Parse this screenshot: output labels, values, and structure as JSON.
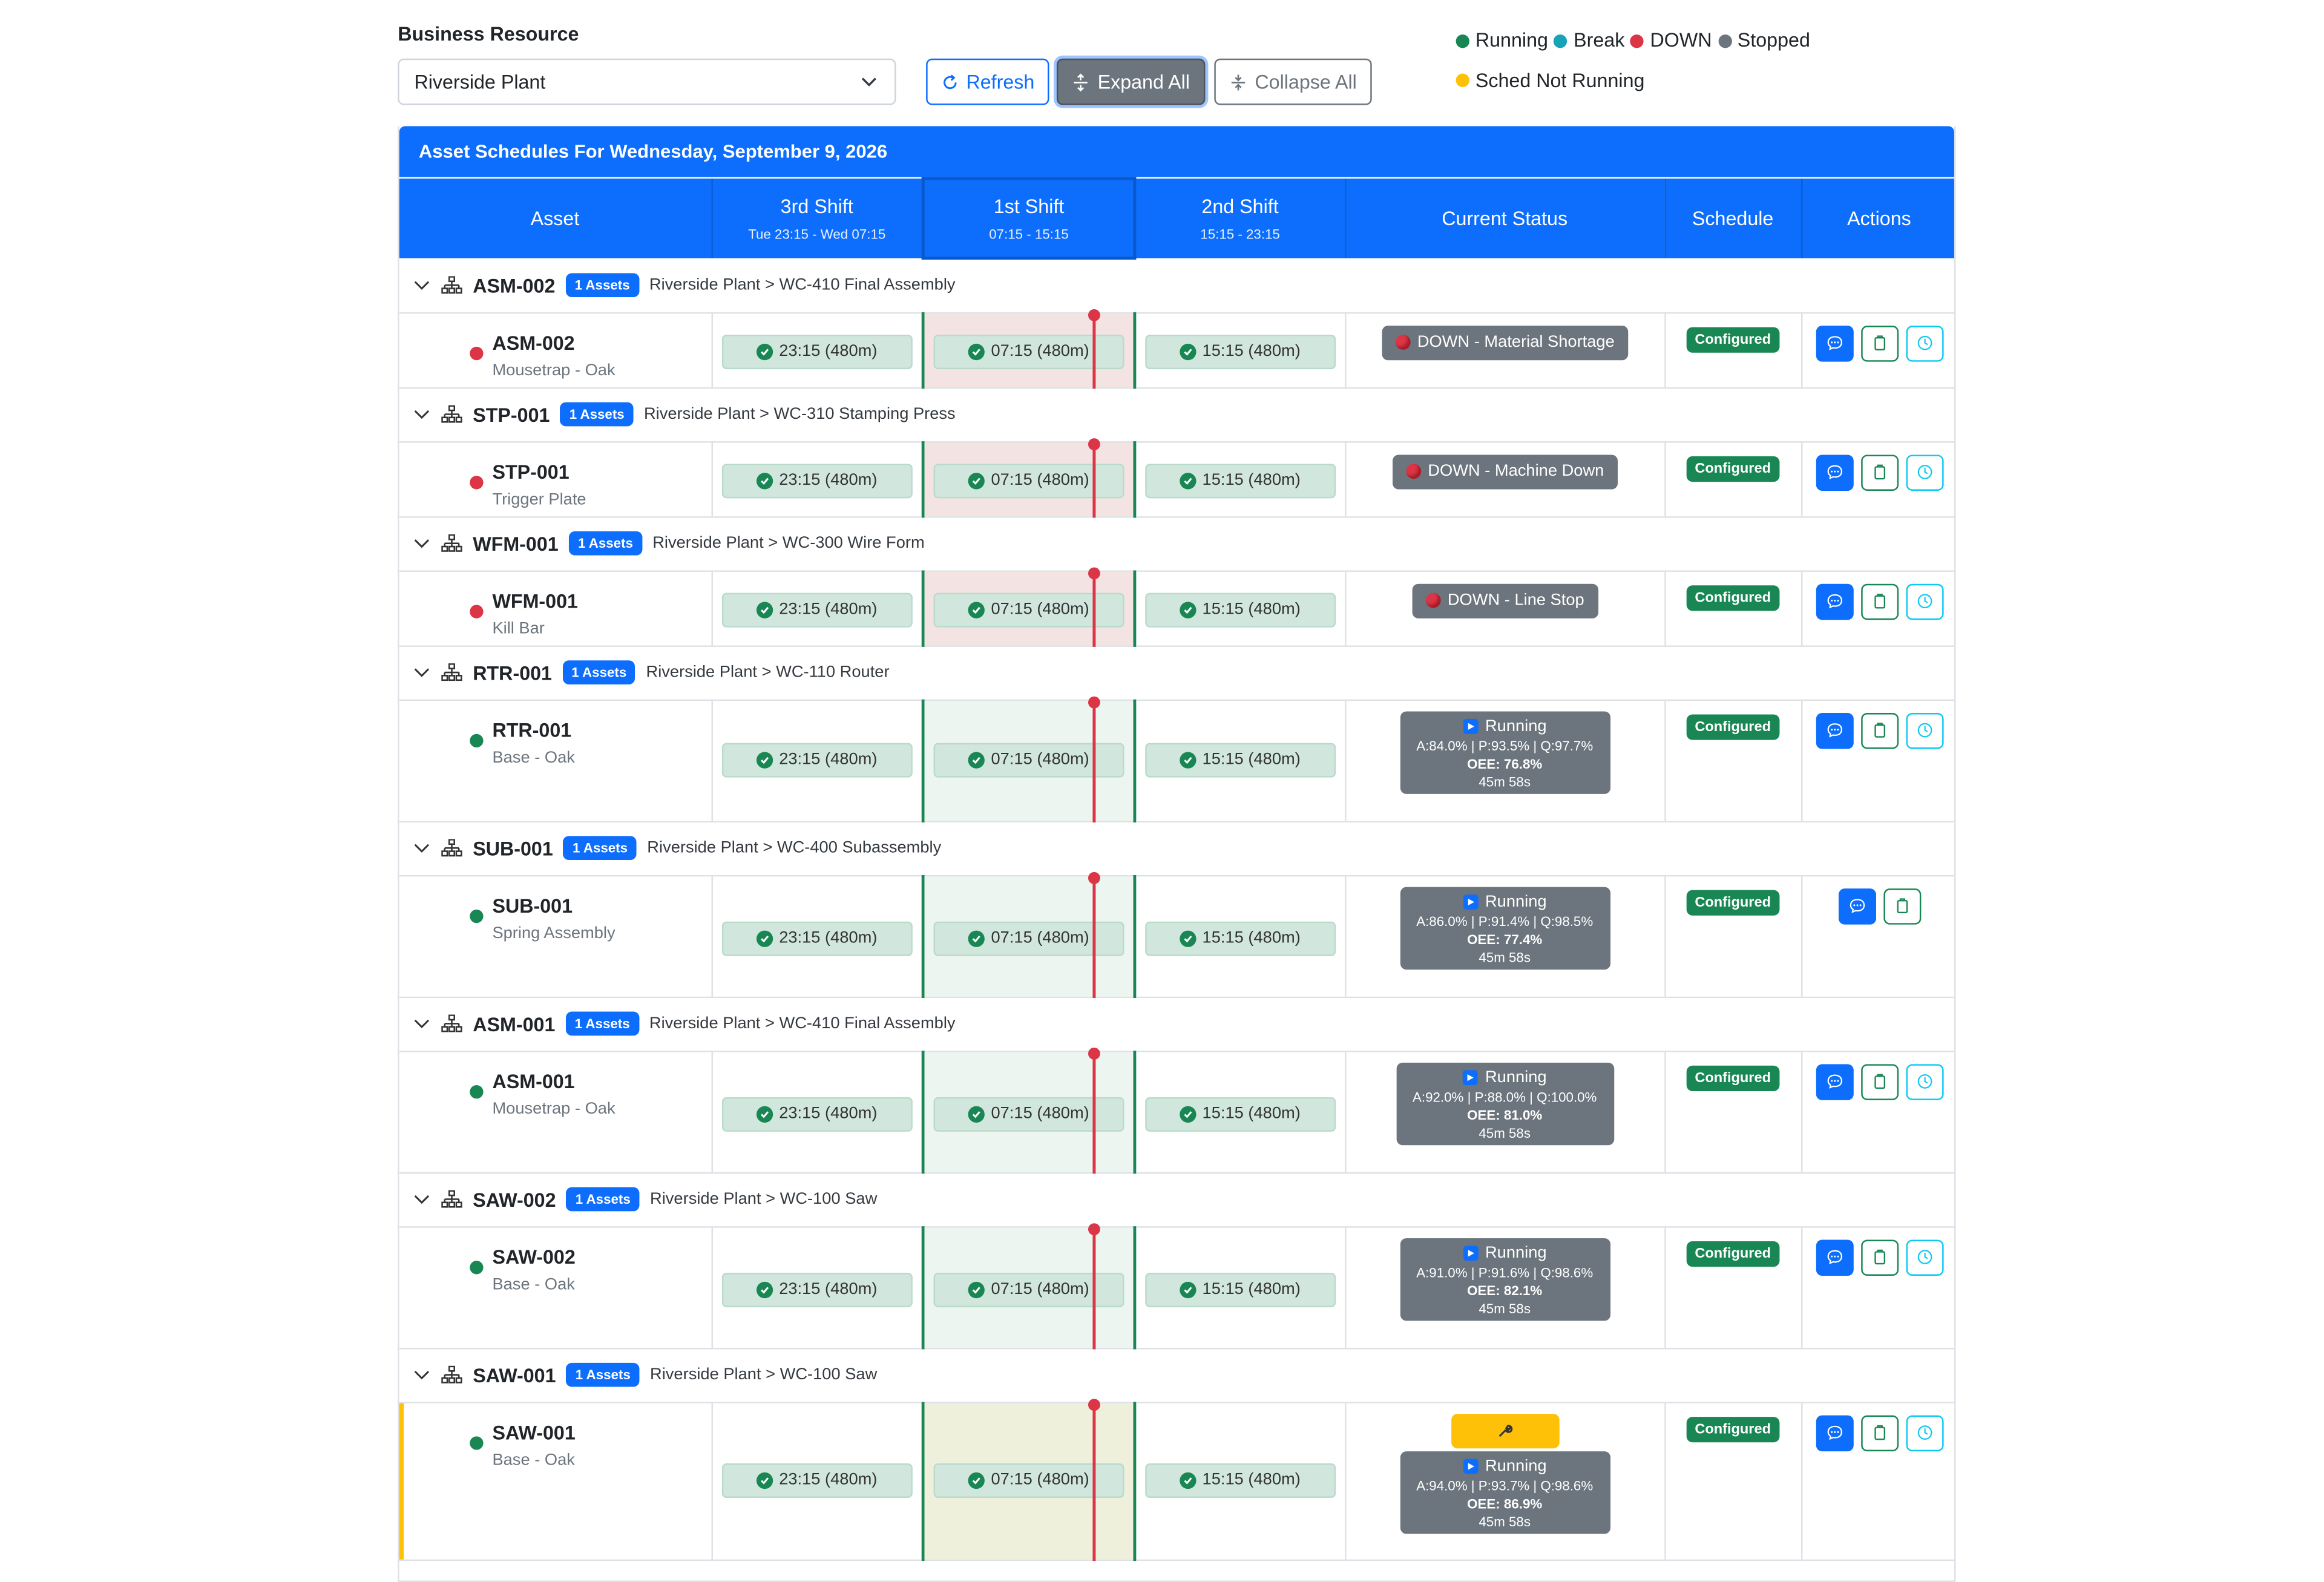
{
  "controls": {
    "business_resource_label": "Business Resource",
    "business_resource_value": "Riverside Plant",
    "refresh_label": "Refresh",
    "expand_label": "Expand All",
    "collapse_label": "Collapse All"
  },
  "legend": [
    {
      "label": "Running",
      "color": "#198754"
    },
    {
      "label": "Break",
      "color": "#17a2b8"
    },
    {
      "label": "DOWN",
      "color": "#dc3545"
    },
    {
      "label": "Stopped",
      "color": "#6c757d"
    },
    {
      "label": "Sched Not Running",
      "color": "#ffc107"
    }
  ],
  "panel": {
    "title": "Asset Schedules For Wednesday, September 9, 2026"
  },
  "columns": {
    "asset": "Asset",
    "shift3": "3rd Shift",
    "shift3_time": "Tue 23:15 - Wed 07:15",
    "shift1": "1st Shift",
    "shift1_time": "07:15 - 15:15",
    "shift2": "2nd Shift",
    "shift2_time": "15:15 - 23:15",
    "status": "Current Status",
    "schedule": "Schedule",
    "actions": "Actions"
  },
  "groups": [
    {
      "id": "ASM-002",
      "badge": "1 Assets",
      "path": "Riverside Plant > WC-410 Final Assembly",
      "asset": {
        "id": "ASM-002",
        "desc": "Mousetrap - Oak",
        "state": "down",
        "status": "DOWN - Material Shortage",
        "shifts": [
          "23:15 (480m)",
          "07:15 (480m)",
          "15:15 (480m)"
        ],
        "schedule": "Configured"
      }
    },
    {
      "id": "STP-001",
      "badge": "1 Assets",
      "path": "Riverside Plant > WC-310 Stamping Press",
      "asset": {
        "id": "STP-001",
        "desc": "Trigger Plate",
        "state": "down",
        "status": "DOWN - Machine Down",
        "shifts": [
          "23:15 (480m)",
          "07:15 (480m)",
          "15:15 (480m)"
        ],
        "schedule": "Configured"
      }
    },
    {
      "id": "WFM-001",
      "badge": "1 Assets",
      "path": "Riverside Plant > WC-300 Wire Form",
      "asset": {
        "id": "WFM-001",
        "desc": "Kill Bar",
        "state": "down",
        "status": "DOWN - Line Stop",
        "shifts": [
          "23:15 (480m)",
          "07:15 (480m)",
          "15:15 (480m)"
        ],
        "schedule": "Configured"
      }
    },
    {
      "id": "RTR-001",
      "badge": "1 Assets",
      "path": "Riverside Plant > WC-110 Router",
      "asset": {
        "id": "RTR-001",
        "desc": "Base - Oak",
        "state": "running",
        "status": "Running",
        "metrics": "A:84.0% | P:93.5% | Q:97.7%",
        "oee": "OEE: 76.8%",
        "duration": "45m 58s",
        "shifts": [
          "23:15 (480m)",
          "07:15 (480m)",
          "15:15 (480m)"
        ],
        "schedule": "Configured"
      }
    },
    {
      "id": "SUB-001",
      "badge": "1 Assets",
      "path": "Riverside Plant > WC-400 Subassembly",
      "asset": {
        "id": "SUB-001",
        "desc": "Spring Assembly",
        "state": "running",
        "status": "Running",
        "metrics": "A:86.0% | P:91.4% | Q:98.5%",
        "oee": "OEE: 77.4%",
        "duration": "45m 58s",
        "shifts": [
          "23:15 (480m)",
          "07:15 (480m)",
          "15:15 (480m)"
        ],
        "schedule": "Configured"
      }
    },
    {
      "id": "ASM-001",
      "badge": "1 Assets",
      "path": "Riverside Plant > WC-410 Final Assembly",
      "asset": {
        "id": "ASM-001",
        "desc": "Mousetrap - Oak",
        "state": "running",
        "status": "Running",
        "metrics": "A:92.0% | P:88.0% | Q:100.0%",
        "oee": "OEE: 81.0%",
        "duration": "45m 58s",
        "shifts": [
          "23:15 (480m)",
          "07:15 (480m)",
          "15:15 (480m)"
        ],
        "schedule": "Configured"
      }
    },
    {
      "id": "SAW-002",
      "badge": "1 Assets",
      "path": "Riverside Plant > WC-100 Saw",
      "asset": {
        "id": "SAW-002",
        "desc": "Base - Oak",
        "state": "running",
        "status": "Running",
        "metrics": "A:91.0% | P:91.6% | Q:98.6%",
        "oee": "OEE: 82.1%",
        "duration": "45m 58s",
        "shifts": [
          "23:15 (480m)",
          "07:15 (480m)",
          "15:15 (480m)"
        ],
        "schedule": "Configured"
      }
    },
    {
      "id": "SAW-001",
      "badge": "1 Assets",
      "path": "Riverside Plant > WC-100 Saw",
      "asset": {
        "id": "SAW-001",
        "desc": "Base - Oak",
        "state": "running",
        "status": "Running",
        "metrics": "A:94.0% | P:93.7% | Q:98.6%",
        "oee": "OEE: 86.9%",
        "duration": "45m 58s",
        "shifts": [
          "23:15 (480m)",
          "07:15 (480m)",
          "15:15 (480m)"
        ],
        "schedule": "Configured"
      }
    }
  ]
}
